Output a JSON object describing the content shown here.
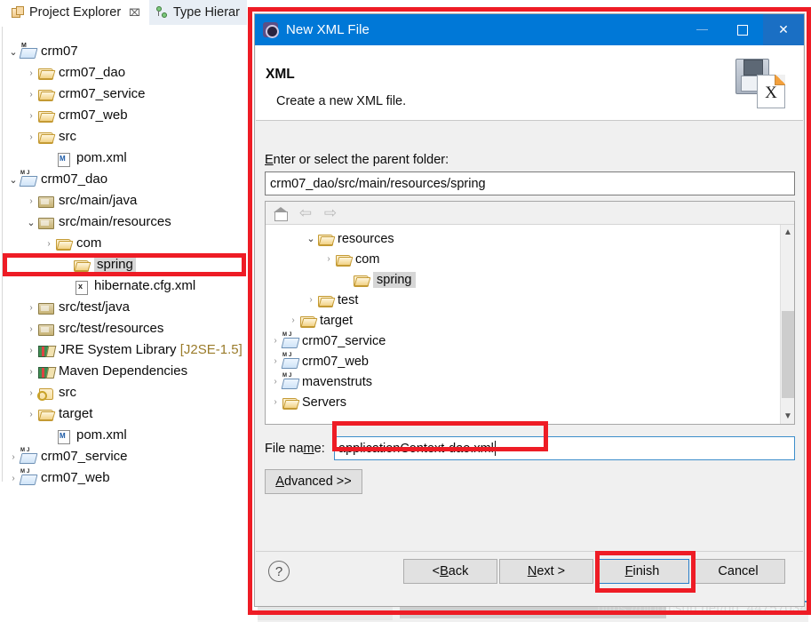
{
  "ide": {
    "tabs": [
      {
        "label": "Project Explorer",
        "icon": "project-explorer-icon",
        "active": true,
        "close": "⌧"
      },
      {
        "label": "Type Hierar",
        "icon": "type-hierarchy-icon",
        "active": false
      }
    ],
    "tree": [
      {
        "label": "crm07",
        "indent": 0,
        "arrow": "down",
        "icon": "mproj"
      },
      {
        "label": "crm07_dao",
        "indent": 1,
        "arrow": "right",
        "icon": "folder"
      },
      {
        "label": "crm07_service",
        "indent": 1,
        "arrow": "right",
        "icon": "folder"
      },
      {
        "label": "crm07_web",
        "indent": 1,
        "arrow": "right",
        "icon": "folder"
      },
      {
        "label": "src",
        "indent": 1,
        "arrow": "right",
        "icon": "folder"
      },
      {
        "label": "pom.xml",
        "indent": 2,
        "arrow": "none",
        "icon": "xmlfile"
      },
      {
        "label": "crm07_dao",
        "indent": 0,
        "arrow": "down",
        "icon": "mjproj"
      },
      {
        "label": "src/main/java",
        "indent": 1,
        "arrow": "right",
        "icon": "srcfolder"
      },
      {
        "label": "src/main/resources",
        "indent": 1,
        "arrow": "down",
        "icon": "srcfolder"
      },
      {
        "label": "com",
        "indent": 2,
        "arrow": "right",
        "icon": "folder"
      },
      {
        "label": "spring",
        "indent": 3,
        "arrow": "none",
        "icon": "folder",
        "selected": true
      },
      {
        "label": "hibernate.cfg.xml",
        "indent": 3,
        "arrow": "none",
        "icon": "hbm"
      },
      {
        "label": "src/test/java",
        "indent": 1,
        "arrow": "right",
        "icon": "srcfolder"
      },
      {
        "label": "src/test/resources",
        "indent": 1,
        "arrow": "right",
        "icon": "srcfolder"
      },
      {
        "label": "JRE System Library",
        "suffix": " [J2SE-1.5]",
        "indent": 1,
        "arrow": "right",
        "icon": "lib"
      },
      {
        "label": "Maven Dependencies",
        "indent": 1,
        "arrow": "right",
        "icon": "lib"
      },
      {
        "label": "src",
        "indent": 1,
        "arrow": "right",
        "icon": "srckey"
      },
      {
        "label": "target",
        "indent": 1,
        "arrow": "right",
        "icon": "folder"
      },
      {
        "label": "pom.xml",
        "indent": 2,
        "arrow": "none",
        "icon": "xmlfile"
      },
      {
        "label": "crm07_service",
        "indent": 0,
        "arrow": "right",
        "icon": "mjproj"
      },
      {
        "label": "crm07_web",
        "indent": 0,
        "arrow": "right",
        "icon": "mjproj"
      }
    ]
  },
  "dialog": {
    "title": "New XML File",
    "heading": "XML",
    "subheading": "Create a new XML file.",
    "header_image_letter": "X",
    "titlebar": {
      "minimize": "minimize-icon",
      "maximize": "maximize-icon",
      "close": "✕"
    },
    "parent_folder": {
      "label_prefix": "E",
      "label_rest": "nter or select the parent folder:",
      "value": "crm07_dao/src/main/resources/spring"
    },
    "folder_tree": {
      "toolbar": [
        "home-icon",
        "back-arrow-icon",
        "forward-arrow-icon"
      ],
      "items": [
        {
          "label": "resources",
          "indent": 2,
          "arrow": "down",
          "icon": "folder"
        },
        {
          "label": "com",
          "indent": 3,
          "arrow": "right",
          "icon": "folder"
        },
        {
          "label": "spring",
          "indent": 4,
          "arrow": "none",
          "icon": "folder",
          "selected": true
        },
        {
          "label": "test",
          "indent": 2,
          "arrow": "right",
          "icon": "folder"
        },
        {
          "label": "target",
          "indent": 1,
          "arrow": "right",
          "icon": "folder"
        },
        {
          "label": "crm07_service",
          "indent": 0,
          "arrow": "right",
          "icon": "mjproj"
        },
        {
          "label": "crm07_web",
          "indent": 0,
          "arrow": "right",
          "icon": "mjproj"
        },
        {
          "label": "mavenstruts",
          "indent": 0,
          "arrow": "right",
          "icon": "mjproj"
        },
        {
          "label": "Servers",
          "indent": 0,
          "arrow": "right",
          "icon": "folder"
        }
      ]
    },
    "file_name": {
      "label_pre": "File na",
      "label_mnemonic": "m",
      "label_post": "e:",
      "value": "applicationContext-dao.xml"
    },
    "buttons": {
      "advanced_mnemonic": "A",
      "advanced_rest": "dvanced >>",
      "back_pre": "< ",
      "back_mnemonic": "B",
      "back_rest": "ack",
      "next_mnemonic": "N",
      "next_rest": "ext >",
      "finish_mnemonic": "F",
      "finish_rest": "inish",
      "cancel": "Cancel",
      "help": "?"
    }
  },
  "watermark": "https://blog.csdn.net/qq_44757034",
  "colors": {
    "titlebar": "#0078d7",
    "annotation": "#ee1c25",
    "focus_border": "#3d8ecb",
    "selection": "#d6d6d6"
  }
}
